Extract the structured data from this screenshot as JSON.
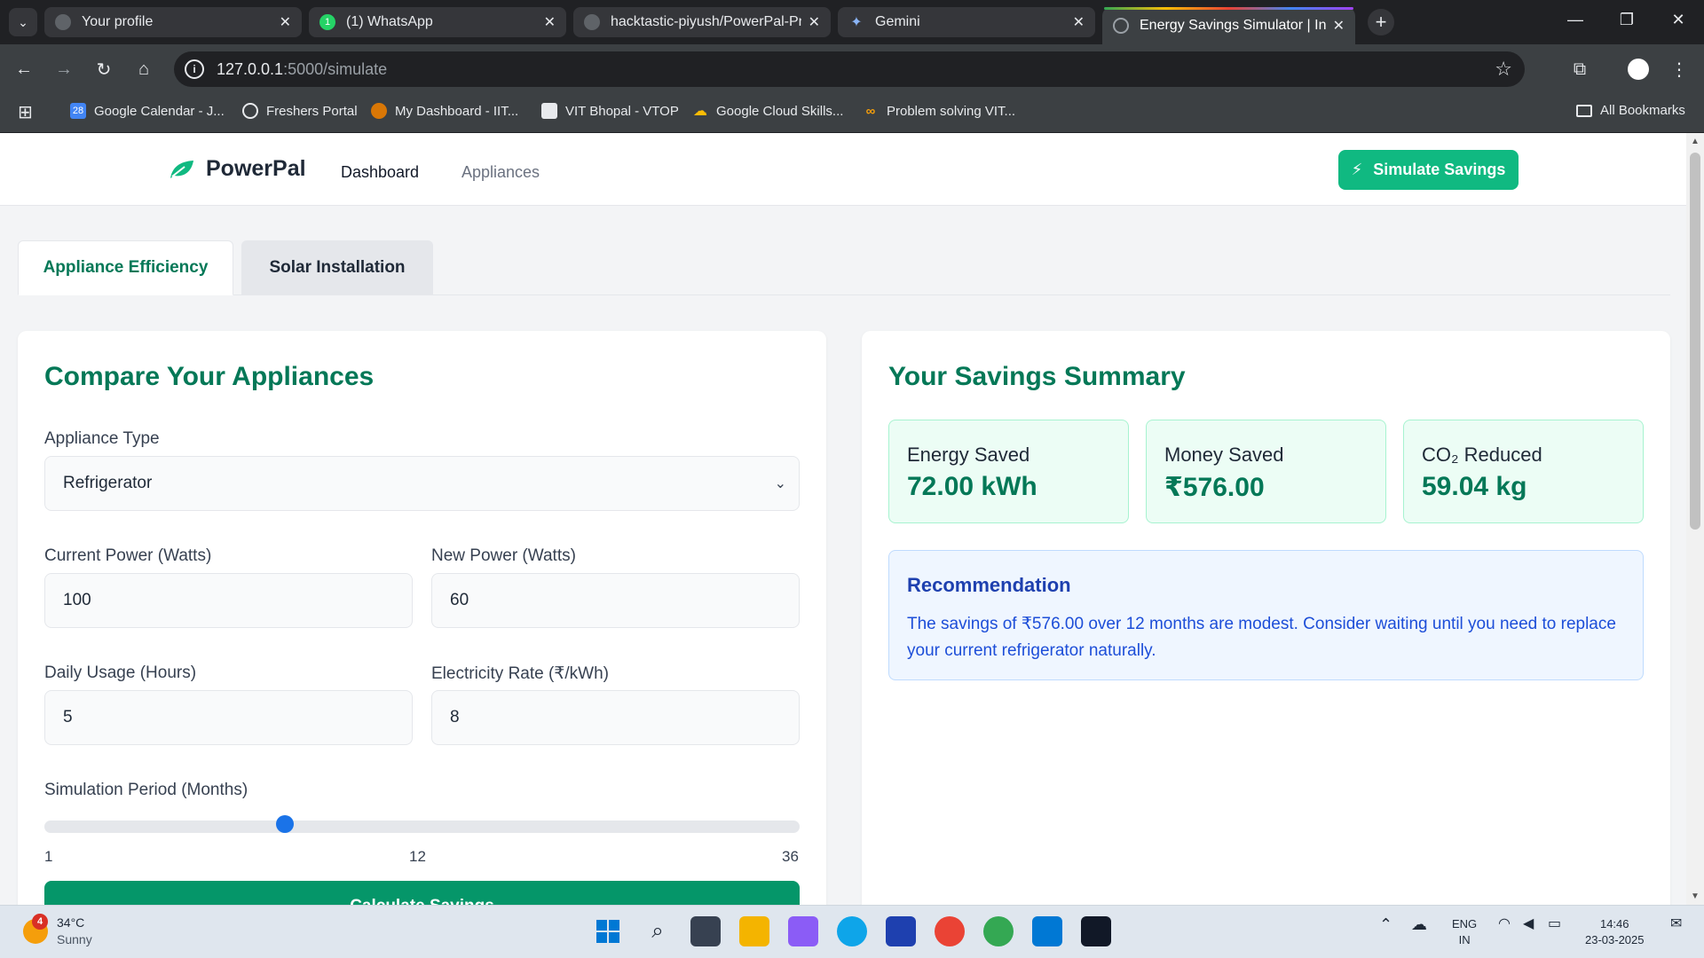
{
  "browser": {
    "tabs": [
      {
        "label": "Your profile"
      },
      {
        "label": "(1) WhatsApp"
      },
      {
        "label": "hacktastic-piyush/PowerPal-Pro"
      },
      {
        "label": "Gemini"
      },
      {
        "label": "Energy Savings Simulator | India"
      }
    ],
    "url_host": "127.0.0.1",
    "url_path": ":5000/simulate",
    "bookmarks": [
      {
        "label": "Google Calendar - J..."
      },
      {
        "label": "Freshers Portal"
      },
      {
        "label": "My Dashboard - IIT..."
      },
      {
        "label": "VIT Bhopal - VTOP"
      },
      {
        "label": "Google Cloud Skills..."
      },
      {
        "label": "Problem solving VIT..."
      }
    ],
    "all_bookmarks": "All Bookmarks",
    "calendar_day": "28"
  },
  "app": {
    "brand": "PowerPal",
    "nav": {
      "dashboard": "Dashboard",
      "appliances": "Appliances"
    },
    "cta": "Simulate Savings",
    "tabs": {
      "efficiency": "Appliance Efficiency",
      "solar": "Solar Installation"
    }
  },
  "form": {
    "title": "Compare Your Appliances",
    "appliance_type_label": "Appliance Type",
    "appliance_type_value": "Refrigerator",
    "current_power_label": "Current Power (Watts)",
    "current_power_value": "100",
    "new_power_label": "New Power (Watts)",
    "new_power_value": "60",
    "daily_usage_label": "Daily Usage (Hours)",
    "daily_usage_value": "5",
    "rate_label": "Electricity Rate (₹/kWh)",
    "rate_value": "8",
    "period_label": "Simulation Period (Months)",
    "period_min": "1",
    "period_mid": "12",
    "period_max": "36",
    "period_value": 12,
    "submit_label": "Calculate Savings"
  },
  "summary": {
    "title": "Your Savings Summary",
    "stats": [
      {
        "label": "Energy Saved",
        "value": "72.00 kWh"
      },
      {
        "label": "Money Saved",
        "value": "₹576.00"
      },
      {
        "label": "CO₂ Reduced",
        "value": "59.04 kg"
      }
    ],
    "recommendation_title": "Recommendation",
    "recommendation_text": "The savings of ₹576.00 over 12 months are modest. Consider waiting until you need to replace your current refrigerator naturally."
  },
  "taskbar": {
    "weather_badge": "4",
    "temperature": "34°C",
    "condition": "Sunny",
    "lang_top": "ENG",
    "lang_bottom": "IN",
    "time": "14:46",
    "date": "23-03-2025"
  },
  "colors": {
    "brand_green": "#10b981",
    "heading_green": "#047857",
    "slider_blue": "#1a73e8",
    "reco_blue": "#1e40af"
  }
}
